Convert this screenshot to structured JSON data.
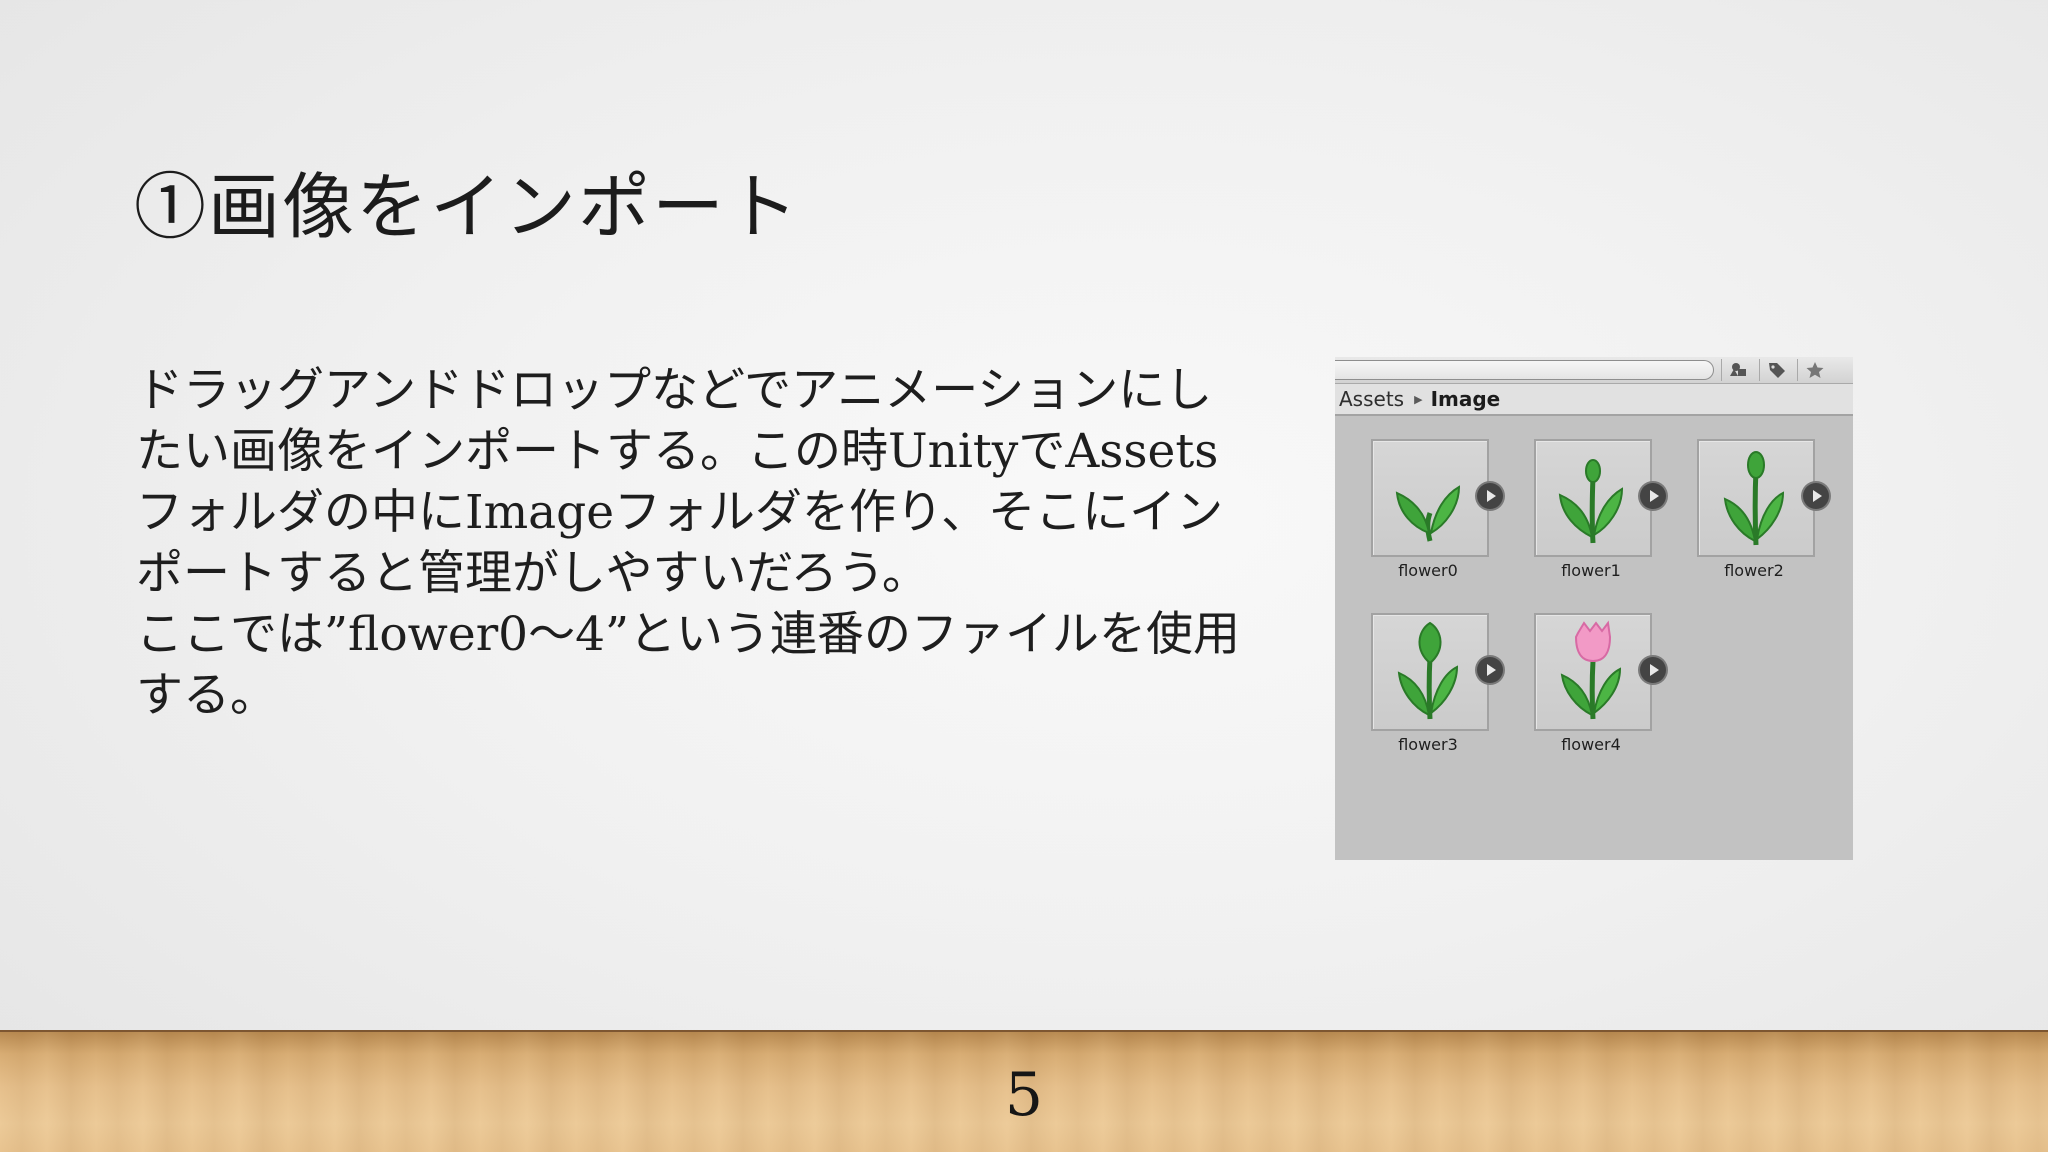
{
  "slide": {
    "title": "①画像をインポート",
    "body_lines": [
      "ドラッグアンドドロップなどでアニメーションにし",
      "たい画像をインポートする。この時UnityでAssets",
      "フォルダの中にImageフォルダを作り、そこにイン",
      "ポートすると管理がしやすいだろう。",
      "ここでは”flower0〜4”という連番のファイルを使用",
      "する。"
    ],
    "page_number": "5"
  },
  "unity_panel": {
    "breadcrumb": {
      "root": "Assets",
      "current": "Image"
    },
    "assets": [
      {
        "label": "flower0",
        "stage": "sprout"
      },
      {
        "label": "flower1",
        "stage": "small-bud"
      },
      {
        "label": "flower2",
        "stage": "tall-bud"
      },
      {
        "label": "flower3",
        "stage": "big-bud"
      },
      {
        "label": "flower4",
        "stage": "pink-tulip"
      }
    ],
    "toolbar_icons": [
      "filter-type-icon",
      "tag-icon",
      "star-icon"
    ]
  },
  "colors": {
    "leaf": "#3fa43a",
    "leaf_dark": "#2a7a28",
    "tulip": "#f29ac6"
  }
}
